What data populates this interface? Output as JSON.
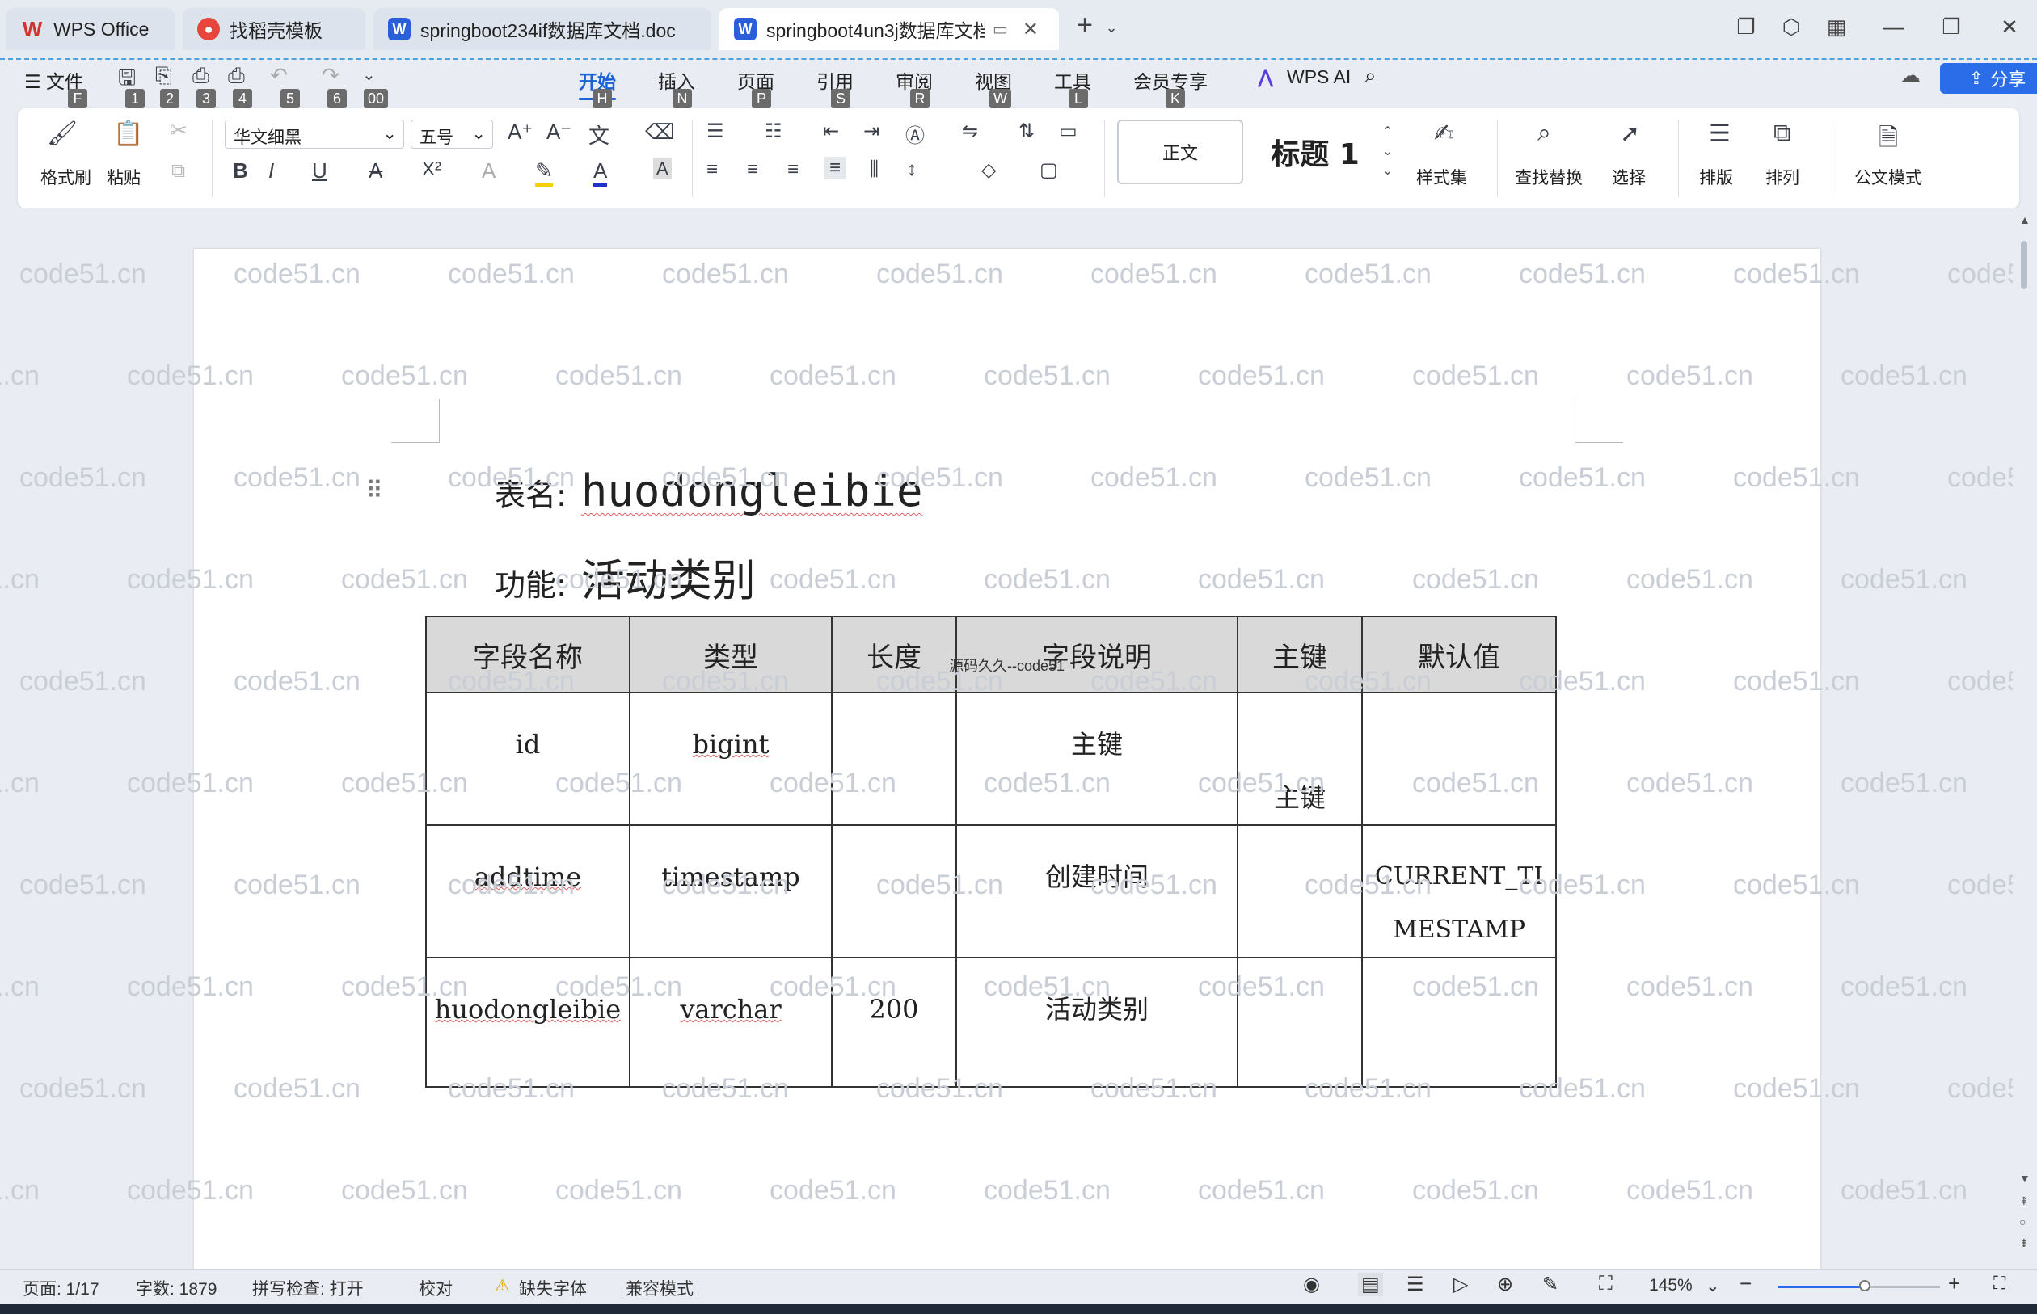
{
  "tabs": [
    {
      "label": "WPS Office",
      "icon_color": "#d0342c"
    },
    {
      "label": "找稻壳模板",
      "icon_color": "#e8453c"
    },
    {
      "label": "springboot234if数据库文档.doc",
      "icon_color": "#2b5fd9"
    },
    {
      "label": "springboot4un3j数据库文档",
      "icon_color": "#2b5fd9"
    }
  ],
  "menu": {
    "file": "文件",
    "items": [
      {
        "label": "开始",
        "key": "H"
      },
      {
        "label": "插入",
        "key": "N"
      },
      {
        "label": "页面",
        "key": "P"
      },
      {
        "label": "引用",
        "key": "S"
      },
      {
        "label": "审阅",
        "key": "R"
      },
      {
        "label": "视图",
        "key": "W"
      },
      {
        "label": "工具",
        "key": "L"
      },
      {
        "label": "会员专享",
        "key": "K"
      }
    ],
    "quick_keys": [
      "F",
      "1",
      "2",
      "3",
      "4",
      "5",
      "6",
      "00"
    ],
    "wps_ai": "WPS AI",
    "share": "分享"
  },
  "ribbon": {
    "format_painter": "格式刷",
    "paste": "粘贴",
    "font_name": "华文细黑",
    "font_size": "五号",
    "style_normal": "正文",
    "style_heading": "标题 1",
    "style_set": "样式集",
    "find_replace": "查找替换",
    "select": "选择",
    "layout": "排版",
    "arrange": "排列",
    "doc_mode": "公文模式"
  },
  "document": {
    "table_label": "表名:",
    "table_name": "huodongleibie",
    "func_label": "功能:",
    "func_name": "活动类别",
    "overlay_text": "源码久久--code51",
    "watermark": "code51.cn",
    "headers": [
      "字段名称",
      "类型",
      "长度",
      "字段说明",
      "主键",
      "默认值"
    ],
    "rows": [
      [
        "id",
        "bigint",
        "",
        "主键",
        "主键",
        ""
      ],
      [
        "addtime",
        "timestamp",
        "",
        "创建时间",
        "",
        "CURRENT_TIMESTAMP"
      ],
      [
        "huodongleibie",
        "varchar",
        "200",
        "活动类别",
        "",
        ""
      ]
    ]
  },
  "status": {
    "page": "页面: 1/17",
    "words": "字数: 1879",
    "spell": "拼写检查: 打开",
    "proof": "校对",
    "missing_font": "缺失字体",
    "compat": "兼容模式",
    "zoom": "145%"
  }
}
